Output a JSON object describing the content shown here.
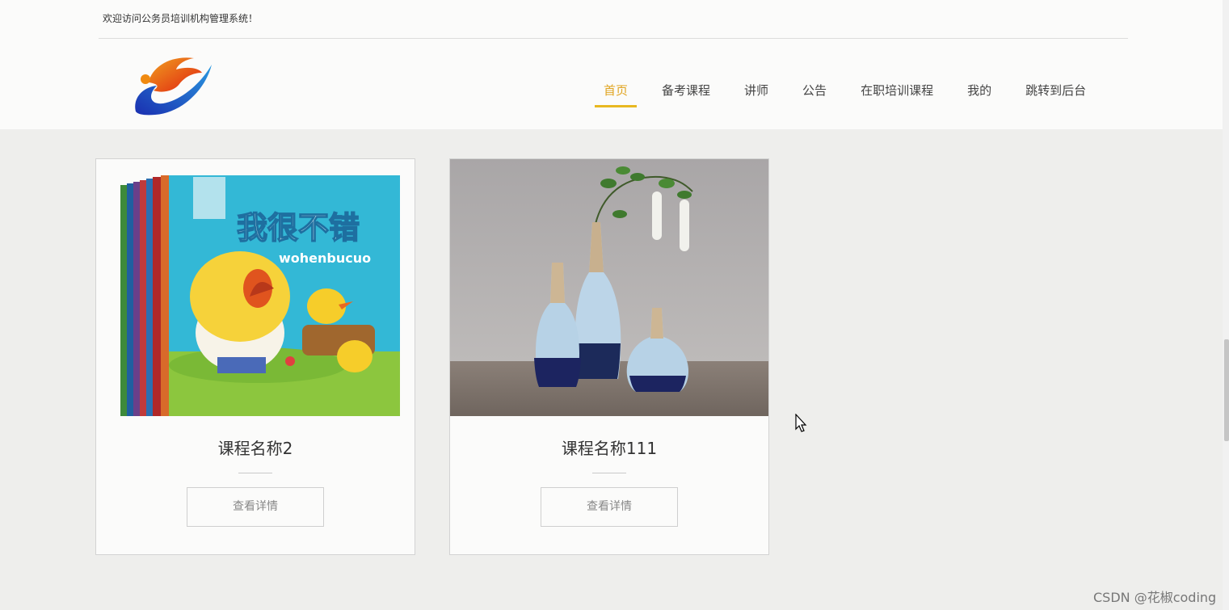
{
  "header": {
    "welcome_text": "欢迎访问公务员培训机构管理系统！"
  },
  "nav": {
    "items": [
      {
        "label": "首页",
        "active": true
      },
      {
        "label": "备考课程",
        "active": false
      },
      {
        "label": "讲师",
        "active": false
      },
      {
        "label": "公告",
        "active": false
      },
      {
        "label": "在职培训课程",
        "active": false
      },
      {
        "label": "我的",
        "active": false
      },
      {
        "label": "跳转到后台",
        "active": false
      }
    ]
  },
  "cards": [
    {
      "title": "课程名称2",
      "button_label": "查看详情",
      "image": "picture-book-cover",
      "cover_title": "我很不错",
      "cover_subtitle": "wohenbucuo"
    },
    {
      "title": "课程名称111",
      "button_label": "查看详情",
      "image": "vases-photo"
    }
  ],
  "watermark": "CSDN @花椒coding",
  "colors": {
    "accent": "#e0a420",
    "background": "#eeeeec",
    "card_bg": "#fbfbfa"
  }
}
